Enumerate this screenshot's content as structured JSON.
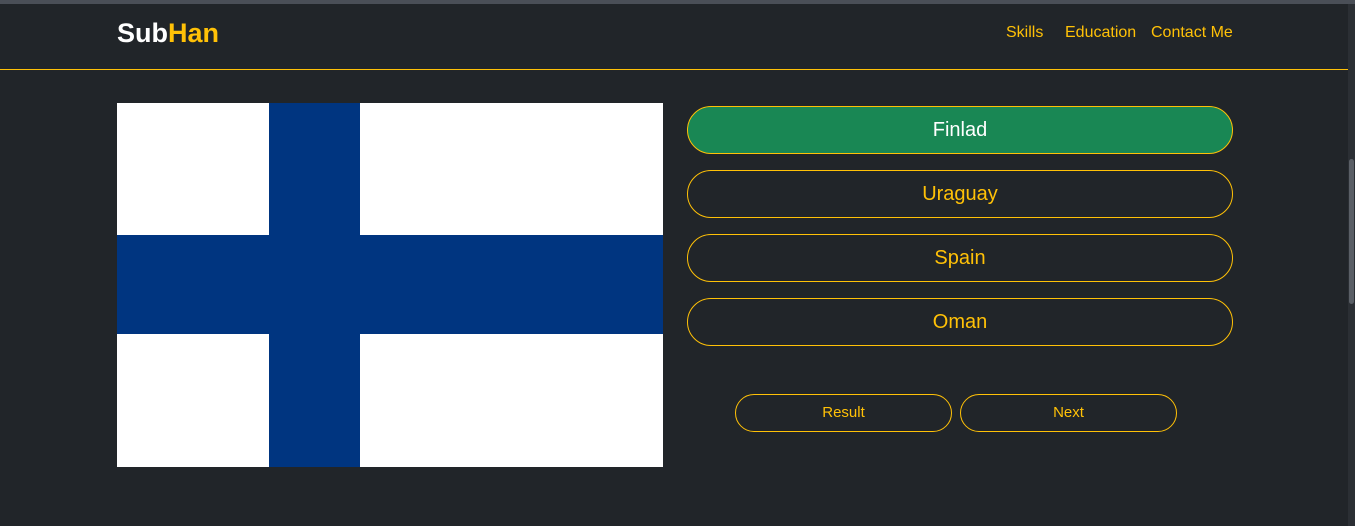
{
  "navbar": {
    "brand_part1": "Sub",
    "brand_part2": "Han",
    "links": [
      {
        "label": "Skills"
      },
      {
        "label": "Education"
      },
      {
        "label": "Contact Me"
      }
    ]
  },
  "quiz": {
    "flag_icon": "finland-flag-icon",
    "options": [
      {
        "label": "Finlad",
        "state": "correct"
      },
      {
        "label": "Uraguay",
        "state": "default"
      },
      {
        "label": "Spain",
        "state": "default"
      },
      {
        "label": "Oman",
        "state": "default"
      }
    ],
    "result_label": "Result",
    "next_label": "Next"
  },
  "colors": {
    "background": "#212529",
    "accent": "#ffc107",
    "correct": "#198754",
    "flag_blue": "#003580",
    "flag_white": "#ffffff"
  }
}
